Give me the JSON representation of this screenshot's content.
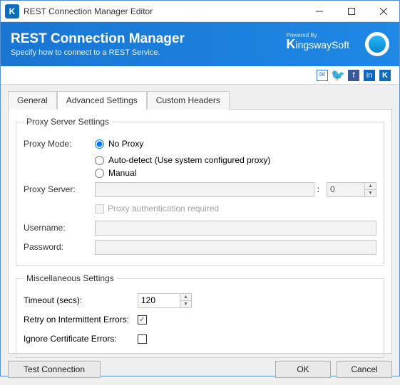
{
  "window": {
    "title": "REST Connection Manager Editor",
    "icon_letter": "K"
  },
  "header": {
    "title": "REST Connection Manager",
    "subtitle": "Specify how to connect to a REST Service.",
    "powered_by": "Powered By",
    "brand_k": "K",
    "brand_name": "ingswaySoft"
  },
  "tabs": {
    "general": "General",
    "advanced": "Advanced Settings",
    "custom": "Custom Headers"
  },
  "proxy": {
    "legend": "Proxy Server Settings",
    "mode_label": "Proxy Mode:",
    "options": {
      "no_proxy": "No Proxy",
      "auto": "Auto-detect (Use system configured proxy)",
      "manual": "Manual"
    },
    "selected": "no_proxy",
    "server_label": "Proxy Server:",
    "server_value": "",
    "port_separator": ":",
    "port_value": "0",
    "auth_required": "Proxy authentication required",
    "username_label": "Username:",
    "username_value": "",
    "password_label": "Password:",
    "password_value": ""
  },
  "misc": {
    "legend": "Miscellaneous Settings",
    "timeout_label": "Timeout (secs):",
    "timeout_value": "120",
    "retry_label": "Retry on Intermittent Errors:",
    "retry_checked": true,
    "ignore_label": "Ignore Certificate Errors:",
    "ignore_checked": false
  },
  "footer": {
    "test": "Test Connection",
    "ok": "OK",
    "cancel": "Cancel"
  }
}
